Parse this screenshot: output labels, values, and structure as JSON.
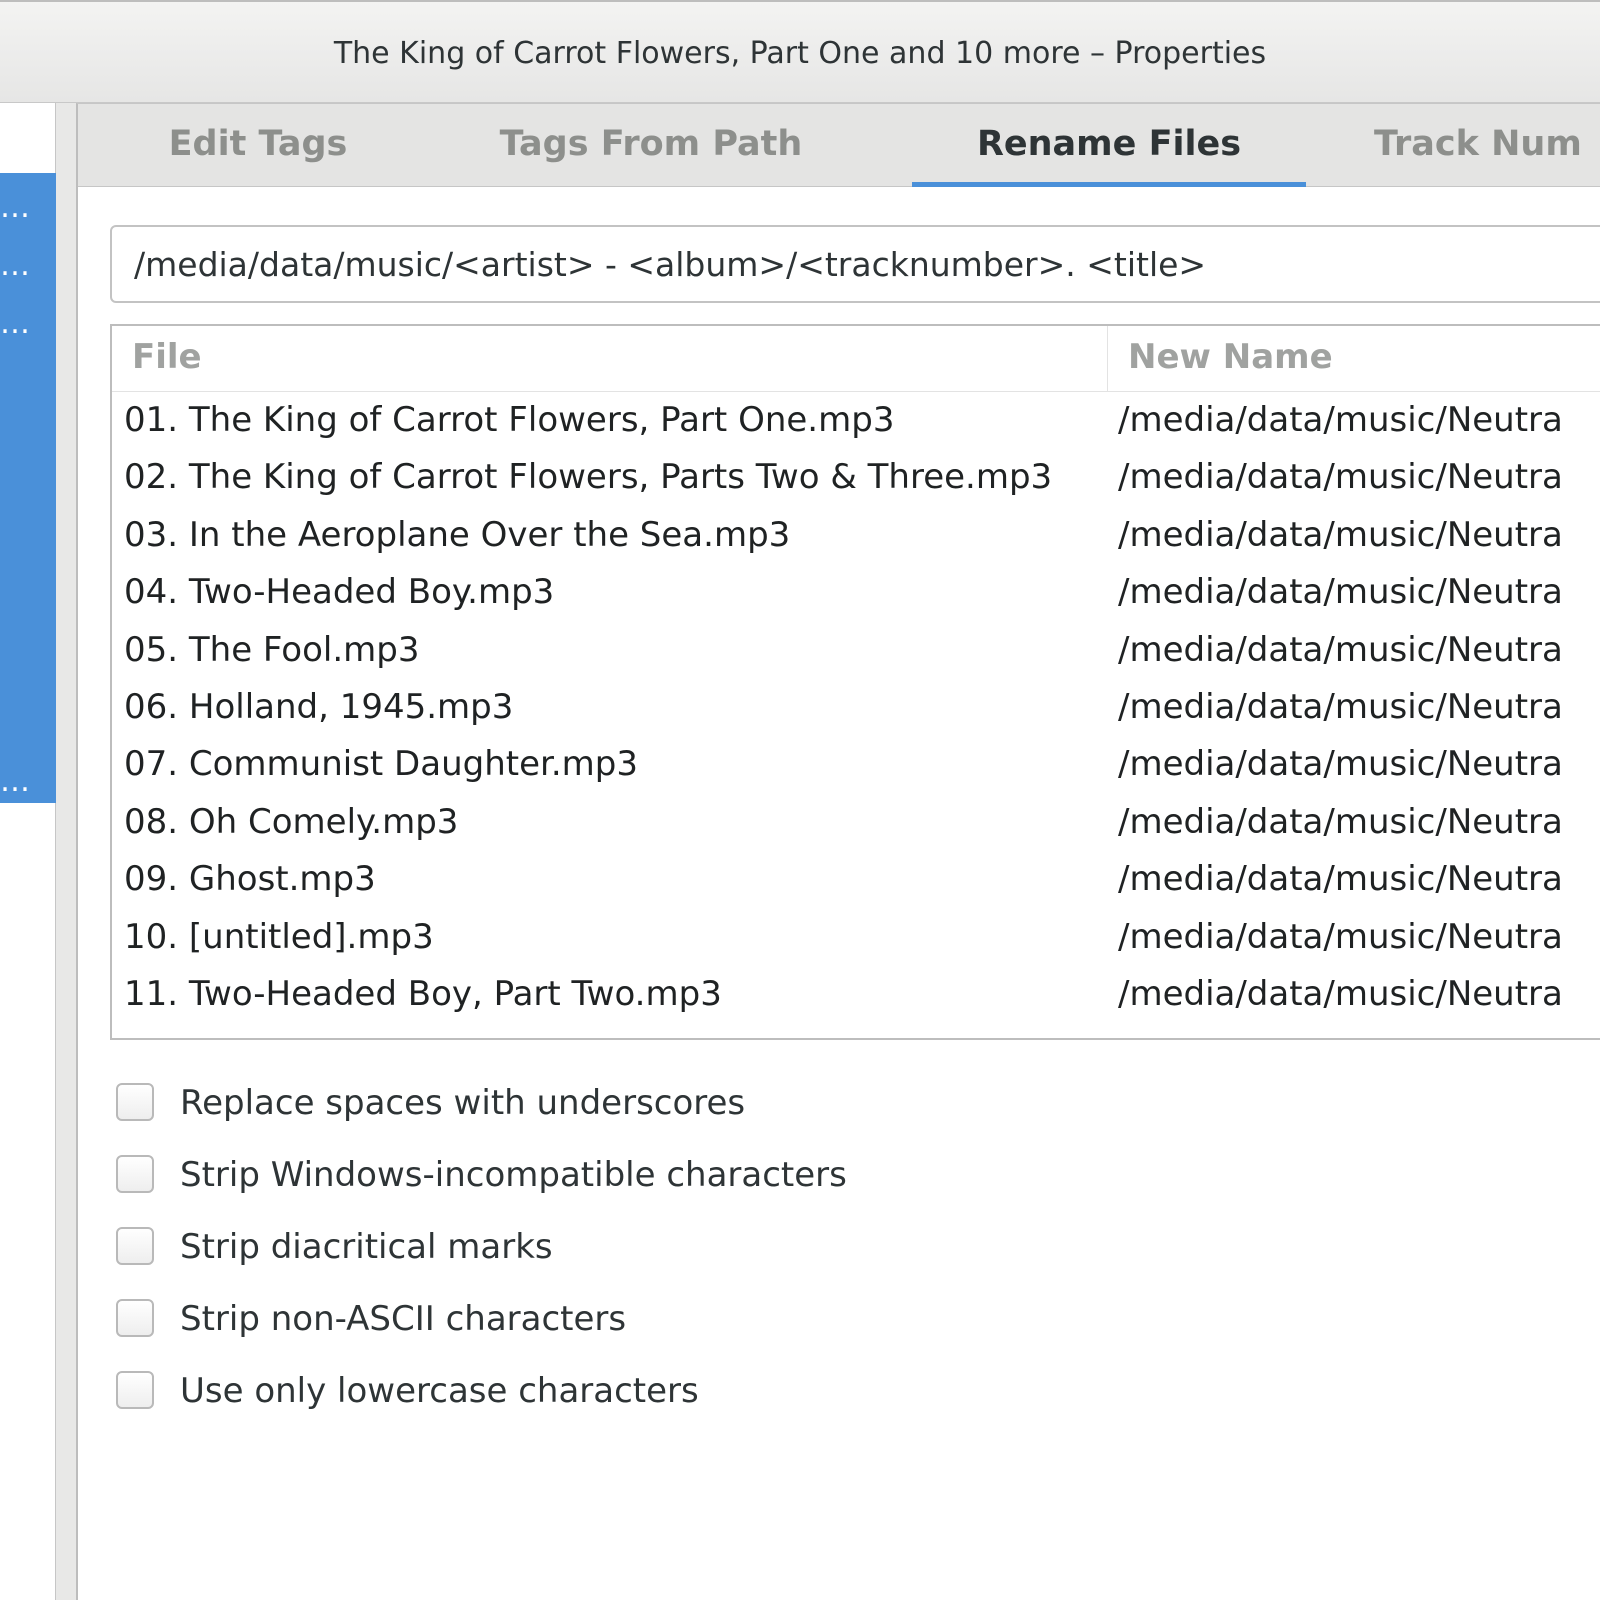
{
  "window": {
    "title": "The King of Carrot Flowers, Part One and 10 more – Properties"
  },
  "sidebar": {
    "truncated_rows": [
      "…",
      "…",
      "…",
      "…"
    ]
  },
  "tabs": [
    {
      "label": "Edit Tags",
      "active": false
    },
    {
      "label": "Tags From Path",
      "active": false
    },
    {
      "label": "Rename Files",
      "active": true
    },
    {
      "label": "Track Num",
      "active": false
    }
  ],
  "pattern": {
    "value": "/media/data/music/<artist> - <album>/<tracknumber>. <title>"
  },
  "table": {
    "headers": {
      "file": "File",
      "new_name": "New Name"
    },
    "rows": [
      {
        "file": "01. The King of Carrot Flowers, Part One.mp3",
        "new_name": "/media/data/music/Neutra"
      },
      {
        "file": "02. The King of Carrot Flowers, Parts Two & Three.mp3",
        "new_name": "/media/data/music/Neutra"
      },
      {
        "file": "03. In the Aeroplane Over the Sea.mp3",
        "new_name": "/media/data/music/Neutra"
      },
      {
        "file": "04. Two-Headed Boy.mp3",
        "new_name": "/media/data/music/Neutra"
      },
      {
        "file": "05. The Fool.mp3",
        "new_name": "/media/data/music/Neutra"
      },
      {
        "file": "06. Holland, 1945.mp3",
        "new_name": "/media/data/music/Neutra"
      },
      {
        "file": "07. Communist Daughter.mp3",
        "new_name": "/media/data/music/Neutra"
      },
      {
        "file": "08. Oh Comely.mp3",
        "new_name": "/media/data/music/Neutra"
      },
      {
        "file": "09. Ghost.mp3",
        "new_name": "/media/data/music/Neutra"
      },
      {
        "file": "10. [untitled].mp3",
        "new_name": "/media/data/music/Neutra"
      },
      {
        "file": "11. Two-Headed Boy, Part Two.mp3",
        "new_name": "/media/data/music/Neutra"
      }
    ]
  },
  "options": [
    {
      "label": "Replace spaces with underscores",
      "checked": false
    },
    {
      "label": "Strip Windows-incompatible characters",
      "checked": false
    },
    {
      "label": "Strip diacritical marks",
      "checked": false
    },
    {
      "label": "Strip non-ASCII characters",
      "checked": false
    },
    {
      "label": "Use only lowercase characters",
      "checked": false
    }
  ],
  "colors": {
    "accent": "#4a90d9",
    "text": "#2e3436",
    "muted": "#8d8f8c"
  }
}
